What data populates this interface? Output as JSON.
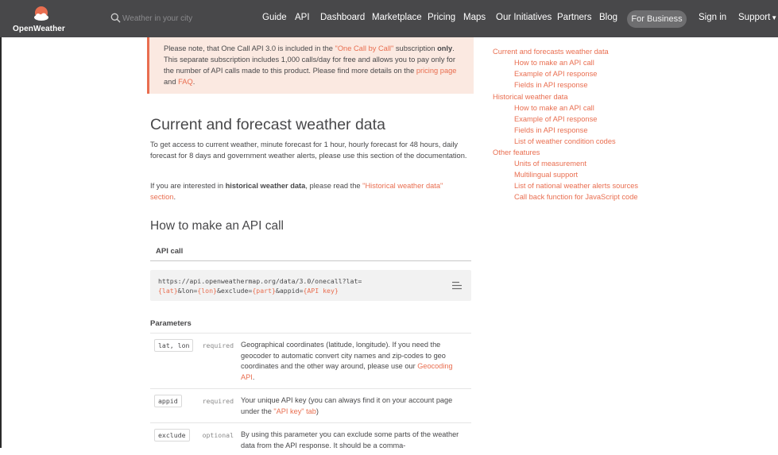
{
  "header": {
    "logo_text": "OpenWeather",
    "search_placeholder": "Weather in your city",
    "nav": [
      {
        "label": "Guide"
      },
      {
        "label": "API"
      },
      {
        "label": "Dashboard"
      },
      {
        "label": "Marketplace"
      },
      {
        "label": "Pricing"
      },
      {
        "label": "Maps"
      },
      {
        "label": "Our Initiatives"
      },
      {
        "label": "Partners"
      },
      {
        "label": "Blog"
      }
    ],
    "business_button": "For Business",
    "sign_in": "Sign in",
    "support": "Support"
  },
  "notice": {
    "t1": "Please note, that One Call API 3.0 is included in the ",
    "link1": "\"One Call by Call\"",
    "t2": " subscription ",
    "bold": "only",
    "t3": ". This separate subscription includes 1,000 calls/day for free and allows you to pay only for the number of API calls made to this product. Please find more details on the ",
    "link2": "pricing page",
    "t4": " and ",
    "link3": "FAQ",
    "t5": "."
  },
  "main": {
    "title": "Current and forecast weather data",
    "intro": "To get access to current weather, minute forecast for 1 hour, hourly forecast for 48 hours, daily forecast for 8 days and government weather alerts, please use this section of the documentation.",
    "historical_t1": "If you are interested in ",
    "historical_bold": "historical weather data",
    "historical_t2": ", please read the ",
    "historical_link": "\"Historical weather data\" section",
    "historical_t3": ".",
    "howto_title": "How to make an API call",
    "api_call_label": "API call",
    "code": {
      "line1": "https://api.openweathermap.org/data/3.0/onecall?lat=",
      "p_lat": "{lat}",
      "t_lon": "&lon=",
      "p_lon": "{lon}",
      "t_exclude": "&exclude=",
      "p_part": "{part}",
      "t_appid": "&appid=",
      "p_key": "{API key}"
    },
    "params_label": "Parameters",
    "params": [
      {
        "name": "lat, lon",
        "req": "required",
        "desc": "Geographical coordinates (latitude, longitude). If you need the geocoder to automatic convert city names and zip-codes to geo coordinates and the other way around, please use our ",
        "link": "Geocoding API",
        "desc_end": "."
      },
      {
        "name": "appid",
        "req": "required",
        "desc": "Your unique API key (you can always find it on your account page under the ",
        "link": "\"API key\" tab",
        "desc_end": ")"
      },
      {
        "name": "exclude",
        "req": "optional",
        "desc": "By using this parameter you can exclude some parts of the weather data from the API response. It should be a comma-"
      }
    ]
  },
  "toc": [
    {
      "label": "Current and forecasts weather data",
      "level": 0
    },
    {
      "label": "How to make an API call",
      "level": 1
    },
    {
      "label": "Example of API response",
      "level": 1
    },
    {
      "label": "Fields in API response",
      "level": 1
    },
    {
      "label": "Historical weather data",
      "level": 0
    },
    {
      "label": "How to make an API call",
      "level": 1
    },
    {
      "label": "Example of API response",
      "level": 1
    },
    {
      "label": "Fields in API response",
      "level": 1
    },
    {
      "label": "List of weather condition codes",
      "level": 1
    },
    {
      "label": "Other features",
      "level": 0
    },
    {
      "label": "Units of measurement",
      "level": 1
    },
    {
      "label": "Multilingual support",
      "level": 1
    },
    {
      "label": "List of national weather alerts sources",
      "level": 1
    },
    {
      "label": "Call back function for JavaScript code",
      "level": 1
    }
  ],
  "colors": {
    "header_bg": "#48484a",
    "accent": "#e96e50",
    "notice_bg": "#fbe9e1",
    "code_bg": "#f2f2f2"
  }
}
